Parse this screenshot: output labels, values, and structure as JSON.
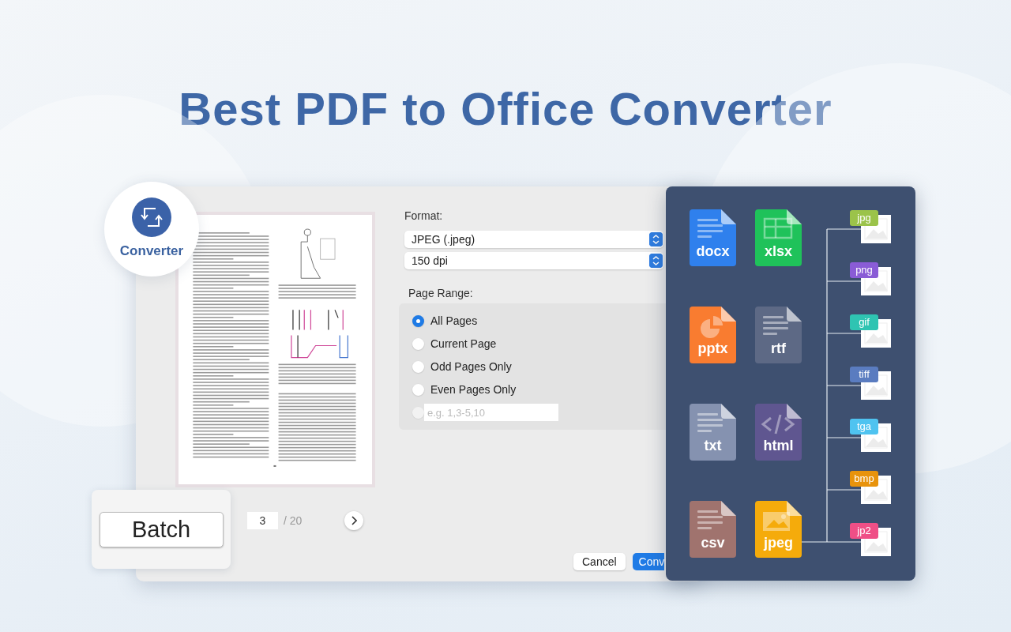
{
  "headline": "Best PDF to Office Converter",
  "app_badge": {
    "label": "Converter"
  },
  "dialog": {
    "format_label": "Format:",
    "format": "JPEG (.jpeg)",
    "resolution": "150 dpi",
    "page_range_label": "Page Range:",
    "page_options": [
      {
        "label": "All Pages",
        "selected": true
      },
      {
        "label": "Current Page",
        "selected": false
      },
      {
        "label": "Odd Pages Only",
        "selected": false
      },
      {
        "label": "Even Pages Only",
        "selected": false
      }
    ],
    "custom_range": {
      "placeholder": "e.g. 1,3-5,10",
      "selected": false
    },
    "current_page": "3",
    "page_total": "/ 20",
    "buttons": [
      {
        "label": "Cancel",
        "kind": "secondary"
      },
      {
        "label": "Conv",
        "kind": "primary"
      }
    ]
  },
  "batch_button": {
    "label": "Batch"
  },
  "output_formats": {
    "documents": [
      {
        "label": "docx",
        "color": "#2f80ed",
        "kind": "lines"
      },
      {
        "label": "xlsx",
        "color": "#1fc25a",
        "kind": "table"
      },
      {
        "label": "pptx",
        "color": "#f97c30",
        "kind": "chart"
      },
      {
        "label": "rtf",
        "color": "#5d6985",
        "kind": "lines"
      },
      {
        "label": "txt",
        "color": "#8592b0",
        "kind": "lines"
      },
      {
        "label": "html",
        "color": "#5f5690",
        "kind": "code"
      },
      {
        "label": "csv",
        "color": "#a0736e",
        "kind": "lines"
      },
      {
        "label": "jpeg",
        "color": "#f5ab0b",
        "kind": "image"
      }
    ],
    "images": [
      {
        "label": "jpg",
        "color": "#9bc34a"
      },
      {
        "label": "png",
        "color": "#8a5cd6"
      },
      {
        "label": "gif",
        "color": "#2fc4b2"
      },
      {
        "label": "tiff",
        "color": "#5a7cc0"
      },
      {
        "label": "tga",
        "color": "#4fc3f0"
      },
      {
        "label": "bmp",
        "color": "#e8930c"
      },
      {
        "label": "jp2",
        "color": "#ef4f86"
      }
    ]
  }
}
